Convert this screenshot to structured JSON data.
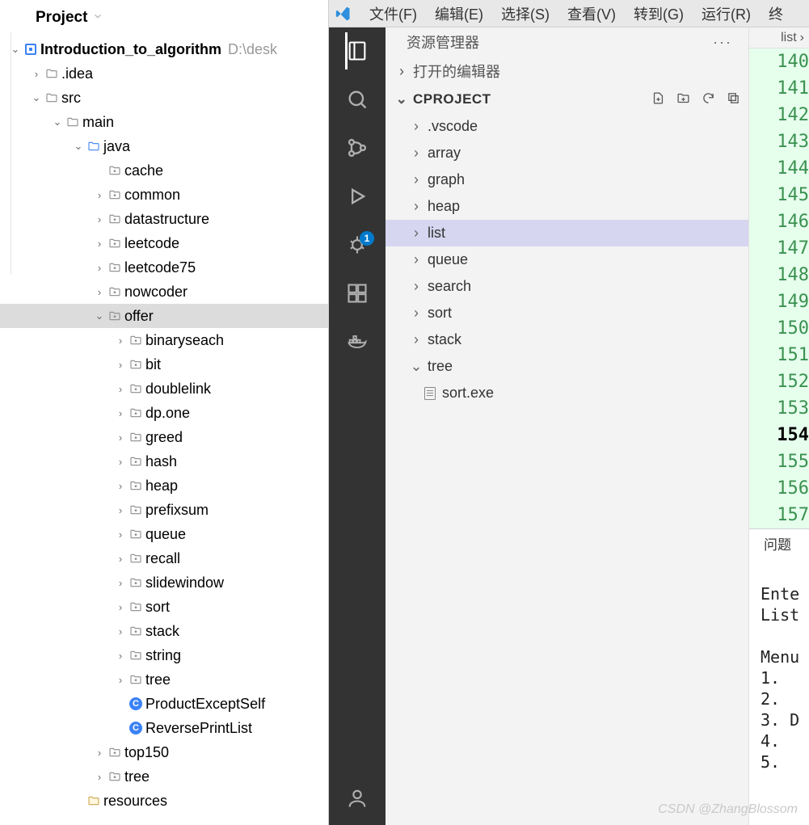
{
  "ij": {
    "title": "Project",
    "tree": [
      {
        "d": 0,
        "arrow": "v",
        "icon": "mod",
        "label": "Introduction_to_algorithm",
        "bold": true,
        "path": "D:\\desk"
      },
      {
        "d": 1,
        "arrow": ">",
        "icon": "folder",
        "label": ".idea"
      },
      {
        "d": 1,
        "arrow": "v",
        "icon": "folder",
        "label": "src"
      },
      {
        "d": 2,
        "arrow": "v",
        "icon": "folder",
        "label": "main"
      },
      {
        "d": 3,
        "arrow": "v",
        "icon": "folder-blue",
        "label": "java"
      },
      {
        "d": 4,
        "arrow": "",
        "icon": "pkg",
        "label": "cache"
      },
      {
        "d": 4,
        "arrow": ">",
        "icon": "pkg",
        "label": "common"
      },
      {
        "d": 4,
        "arrow": ">",
        "icon": "pkg",
        "label": "datastructure"
      },
      {
        "d": 4,
        "arrow": ">",
        "icon": "pkg",
        "label": "leetcode"
      },
      {
        "d": 4,
        "arrow": ">",
        "icon": "pkg",
        "label": "leetcode75"
      },
      {
        "d": 4,
        "arrow": ">",
        "icon": "pkg",
        "label": "nowcoder"
      },
      {
        "d": 4,
        "arrow": "v",
        "icon": "pkg",
        "label": "offer",
        "selected": true
      },
      {
        "d": 5,
        "arrow": ">",
        "icon": "pkg",
        "label": "binaryseach"
      },
      {
        "d": 5,
        "arrow": ">",
        "icon": "pkg",
        "label": "bit"
      },
      {
        "d": 5,
        "arrow": ">",
        "icon": "pkg",
        "label": "doublelink"
      },
      {
        "d": 5,
        "arrow": ">",
        "icon": "pkg",
        "label": "dp.one"
      },
      {
        "d": 5,
        "arrow": ">",
        "icon": "pkg",
        "label": "greed"
      },
      {
        "d": 5,
        "arrow": ">",
        "icon": "pkg",
        "label": "hash"
      },
      {
        "d": 5,
        "arrow": ">",
        "icon": "pkg",
        "label": "heap"
      },
      {
        "d": 5,
        "arrow": ">",
        "icon": "pkg",
        "label": "prefixsum"
      },
      {
        "d": 5,
        "arrow": ">",
        "icon": "pkg",
        "label": "queue"
      },
      {
        "d": 5,
        "arrow": ">",
        "icon": "pkg",
        "label": "recall"
      },
      {
        "d": 5,
        "arrow": ">",
        "icon": "pkg",
        "label": "slidewindow"
      },
      {
        "d": 5,
        "arrow": ">",
        "icon": "pkg",
        "label": "sort"
      },
      {
        "d": 5,
        "arrow": ">",
        "icon": "pkg",
        "label": "stack"
      },
      {
        "d": 5,
        "arrow": ">",
        "icon": "pkg",
        "label": "string"
      },
      {
        "d": 5,
        "arrow": ">",
        "icon": "pkg",
        "label": "tree"
      },
      {
        "d": 5,
        "arrow": "",
        "icon": "c",
        "label": "ProductExceptSelf"
      },
      {
        "d": 5,
        "arrow": "",
        "icon": "c",
        "label": "ReversePrintList"
      },
      {
        "d": 4,
        "arrow": ">",
        "icon": "pkg",
        "label": "top150"
      },
      {
        "d": 4,
        "arrow": ">",
        "icon": "pkg",
        "label": "tree"
      },
      {
        "d": 3,
        "arrow": "",
        "icon": "folder-res",
        "label": "resources"
      }
    ]
  },
  "vsc": {
    "menu": [
      "文件(F)",
      "编辑(E)",
      "选择(S)",
      "查看(V)",
      "转到(G)",
      "运行(R)",
      "终"
    ],
    "debugBadge": "1",
    "explorer": {
      "title": "资源管理器",
      "open_editors": "打开的编辑器",
      "project": "CPROJECT",
      "items": [
        {
          "arrow": ">",
          "label": ".vscode"
        },
        {
          "arrow": ">",
          "label": "array"
        },
        {
          "arrow": ">",
          "label": "graph"
        },
        {
          "arrow": ">",
          "label": "heap"
        },
        {
          "arrow": ">",
          "label": "list",
          "selected": true
        },
        {
          "arrow": ">",
          "label": "queue"
        },
        {
          "arrow": ">",
          "label": "search"
        },
        {
          "arrow": ">",
          "label": "sort"
        },
        {
          "arrow": ">",
          "label": "stack"
        },
        {
          "arrow": "v",
          "label": "tree"
        },
        {
          "arrow": "",
          "label": "sort.exe",
          "file": true
        }
      ]
    },
    "crumb": "list",
    "lineNumbers": [
      "140",
      "141",
      "142",
      "143",
      "144",
      "145",
      "146",
      "147",
      "148",
      "149",
      "150",
      "151",
      "152",
      "153",
      "154",
      "155",
      "156",
      "157"
    ],
    "currentLine": "154",
    "terminal": {
      "tab": "问题",
      "lines": [
        "",
        "Ente",
        "List",
        "",
        "Menu",
        "1. ",
        "2. ",
        "3. D",
        "4. ",
        "5. "
      ]
    }
  },
  "watermark": "CSDN @ZhangBlossom"
}
